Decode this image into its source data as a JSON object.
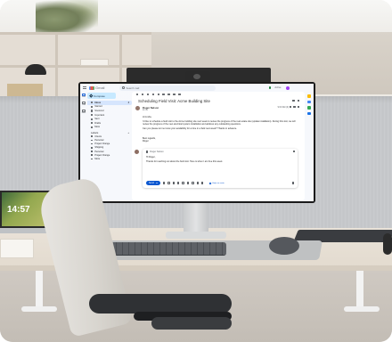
{
  "gmail": {
    "app_name": "Gmail",
    "search_placeholder": "Search mail",
    "status": "Active",
    "compose_label": "Compose",
    "rail": [
      {
        "label": "Mail",
        "icon": "mail-icon"
      },
      {
        "label": "Chat",
        "icon": "chat-icon"
      },
      {
        "label": "Meet",
        "icon": "meet-icon"
      }
    ],
    "nav": [
      {
        "label": "Inbox",
        "icon": "inbox-icon",
        "count": "4",
        "active": true
      },
      {
        "label": "Starred",
        "icon": "star-icon",
        "count": ""
      },
      {
        "label": "Snoozed",
        "icon": "clock-icon",
        "count": ""
      },
      {
        "label": "Important",
        "icon": "important-icon",
        "count": ""
      },
      {
        "label": "Sent",
        "icon": "send-icon",
        "count": ""
      },
      {
        "label": "Drafts",
        "icon": "draft-icon",
        "count": ""
      },
      {
        "label": "More",
        "icon": "chevron-down-icon",
        "count": ""
      }
    ],
    "labels_header": "Labels",
    "labels": [
      "Clients",
      "Personal",
      "Project Orange",
      "Shipping",
      "Personal",
      "Project Orange",
      "More"
    ],
    "message": {
      "subject": "Scheduling Field Visit: Acme Building Site",
      "sender": "Roger Nelson",
      "to": "to me",
      "time": "9:00 AM (0)",
      "greeting": "Hi Linda,",
      "body": "I'd like to schedule a field visit to the Acme building site next week to review the progress of the real estate site (update installation). During this visit, we will review the progress of the new electrical system installation and address any outstanding questions.",
      "body2": "Can you please let me know your availability for a time in a field next week? Thanks in advance.",
      "signoff": "Best regards,",
      "signoff_name": "Roger"
    },
    "reply": {
      "to": "Roger Nelson",
      "greeting": "Hi Roger,",
      "text": "Thanks for reaching out about the field visit. Here is when I am free this week.",
      "send_label": "Send",
      "ai_label": "Help me write"
    }
  },
  "laptop_clock": "14:57"
}
